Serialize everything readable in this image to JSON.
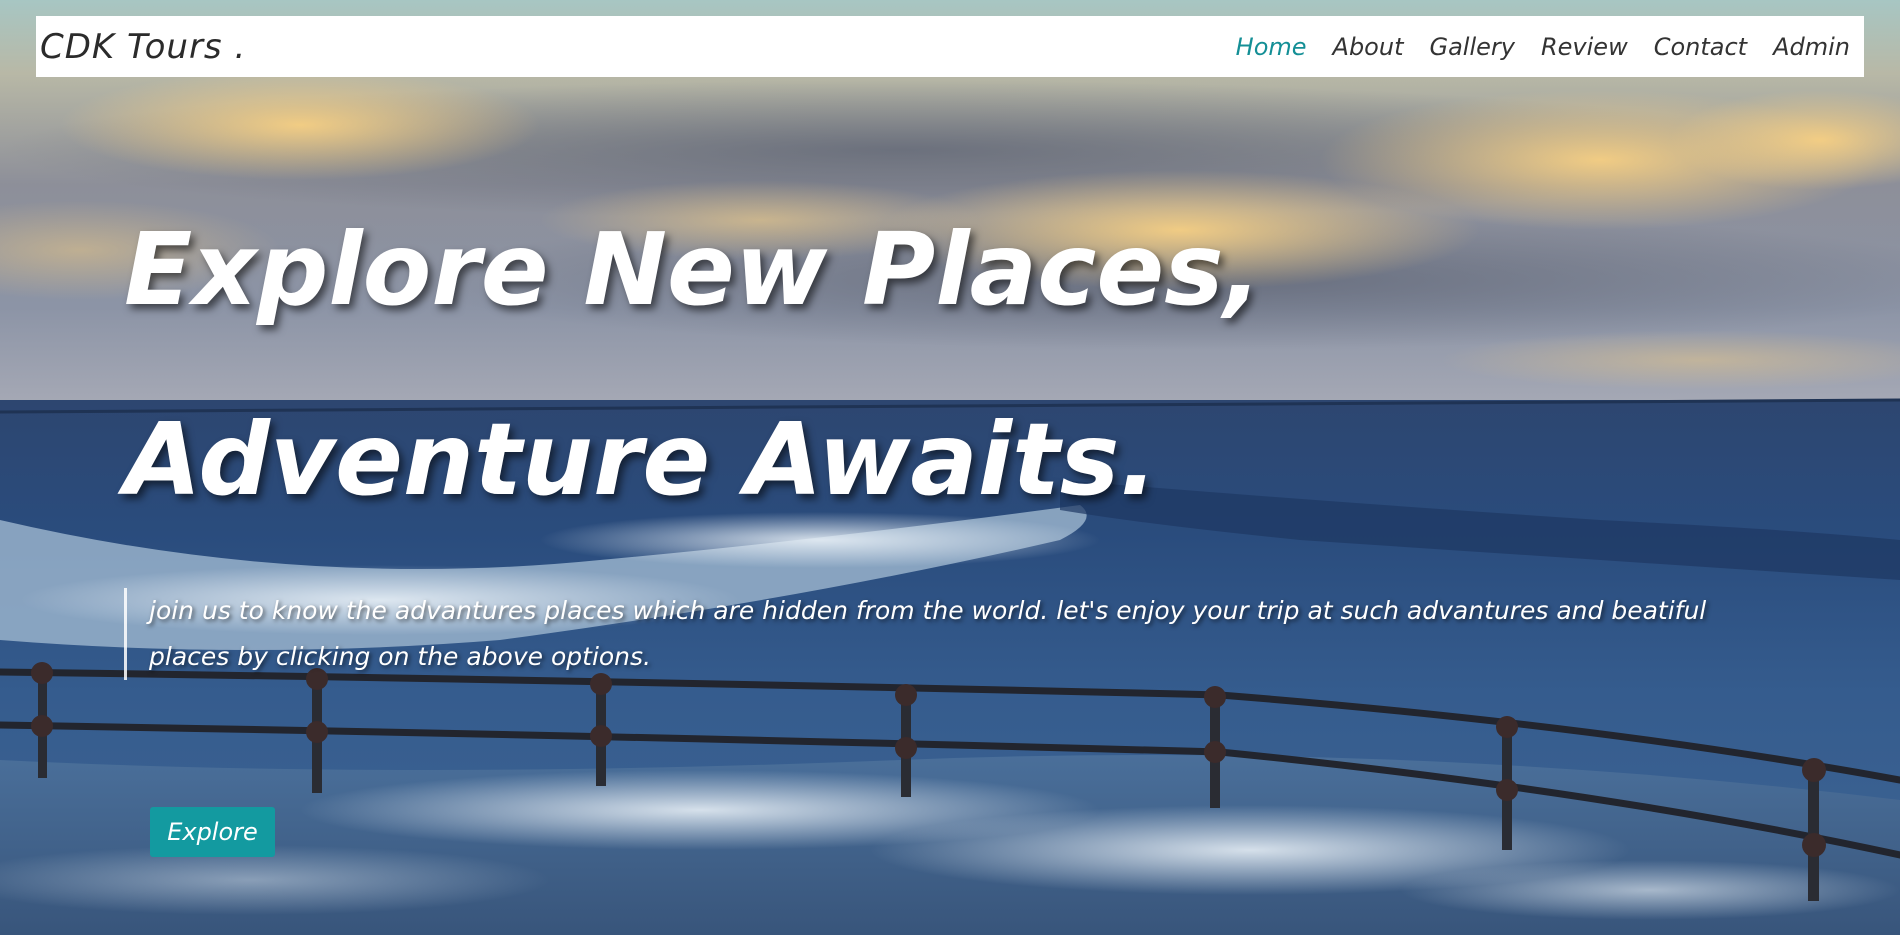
{
  "brand": {
    "logo_text": "CDK Tours ."
  },
  "nav": {
    "items": [
      {
        "label": "Home",
        "active": true
      },
      {
        "label": "About",
        "active": false
      },
      {
        "label": "Gallery",
        "active": false
      },
      {
        "label": "Review",
        "active": false
      },
      {
        "label": "Contact",
        "active": false
      },
      {
        "label": "Admin",
        "active": false
      }
    ]
  },
  "hero": {
    "headline_line1": "Explore New Places,",
    "headline_line2": "Adventure Awaits.",
    "tagline": "join us to know the advantures places which are hidden from the world. let's enjoy your trip at such advantures and beatiful places by clicking on the above options.",
    "cta_label": "Explore",
    "background_scene": "sunset-sea-with-railing"
  },
  "colors": {
    "accent": "#139aa0",
    "nav_active": "#148f96",
    "nav_text": "#333333",
    "navbar_bg": "#ffffff",
    "hero_text": "#ffffff"
  }
}
